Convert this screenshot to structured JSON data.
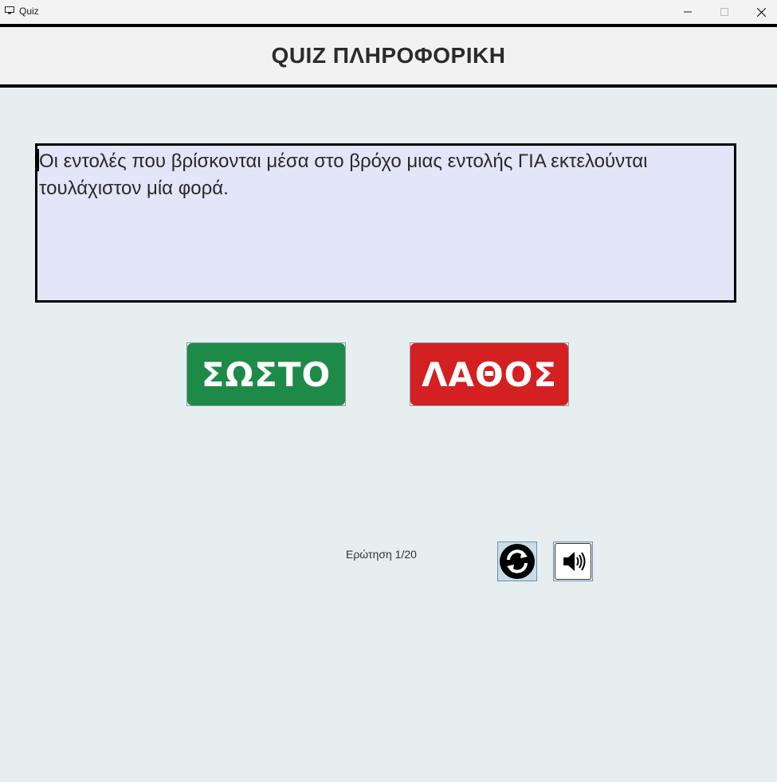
{
  "window": {
    "title": "Quiz",
    "controls": [
      "minimize-icon",
      "maximize-icon",
      "close-icon"
    ]
  },
  "header": {
    "title": "QUIZ ΠΛΗΡΟΦΟΡΙΚΗ"
  },
  "question": {
    "text": "Οι εντολές που βρίσκονται μέσα στο βρόχο μιας εντολής ΓΙΑ εκτελούνται τουλάχιστον μία φορά."
  },
  "answers": {
    "correct_label": "ΣΩΣΤΟ",
    "wrong_label": "ΛΑΘΟΣ"
  },
  "footer": {
    "counter": "Ερώτηση 1/20",
    "refresh_icon": "refresh-icon",
    "sound_icon": "speaker-icon"
  },
  "colors": {
    "correct": "#1e8a47",
    "wrong": "#d42020",
    "question_bg": "#e3e5f8",
    "page_bg": "#e6eef0"
  }
}
